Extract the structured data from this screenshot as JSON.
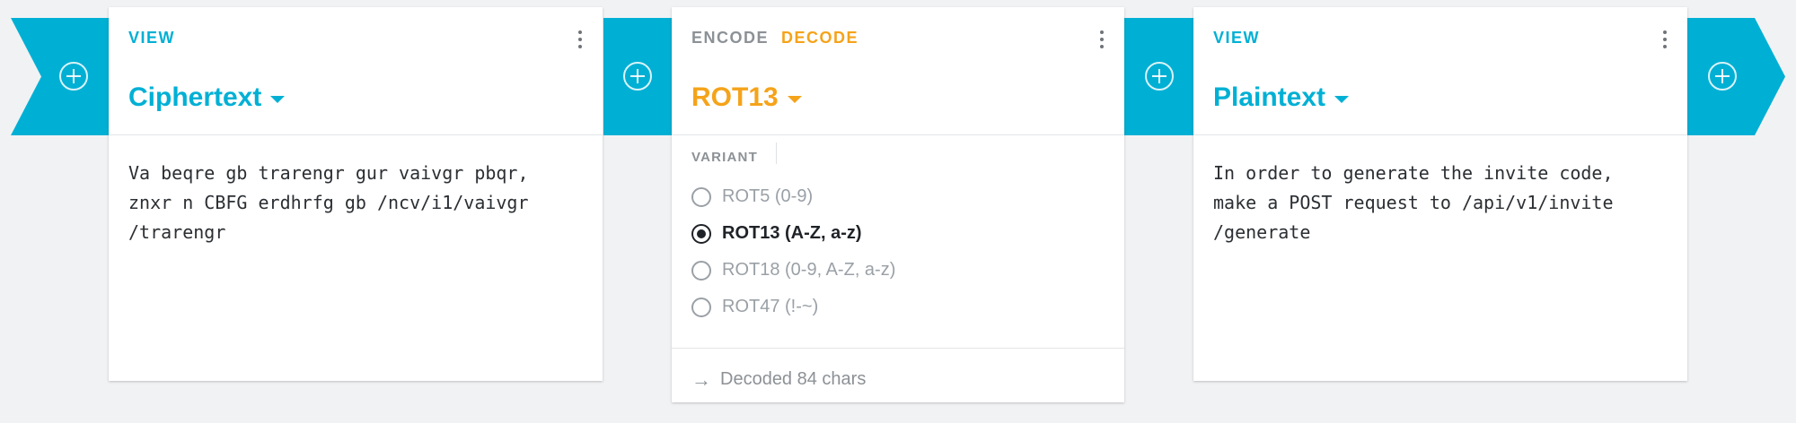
{
  "flow": {
    "add_icon": "plus-circle-icon",
    "accent_color": "#00b0d4",
    "highlight_color": "#f5a31a"
  },
  "cards": [
    {
      "labels": [
        "VIEW"
      ],
      "title": "Ciphertext",
      "content": "Va beqre gb trarengr gur vaivgr pbqr,\nznxr n CBFG erdhrfg gb /ncv/i1/vaivgr\n/trarengr"
    },
    {
      "labels": [
        "ENCODE",
        "DECODE"
      ],
      "title": "ROT13",
      "variant_label": "VARIANT",
      "variants": [
        {
          "label": "ROT5 (0-9)",
          "selected": false
        },
        {
          "label": "ROT13 (A-Z, a-z)",
          "selected": true
        },
        {
          "label": "ROT18 (0-9, A-Z, a-z)",
          "selected": false
        },
        {
          "label": "ROT47 (!-~)",
          "selected": false
        }
      ],
      "status": "Decoded 84 chars",
      "status_icon": "arrow-right-icon"
    },
    {
      "labels": [
        "VIEW"
      ],
      "title": "Plaintext",
      "content": "In order to generate the invite code,\nmake a POST request to /api/v1/invite\n/generate"
    }
  ]
}
